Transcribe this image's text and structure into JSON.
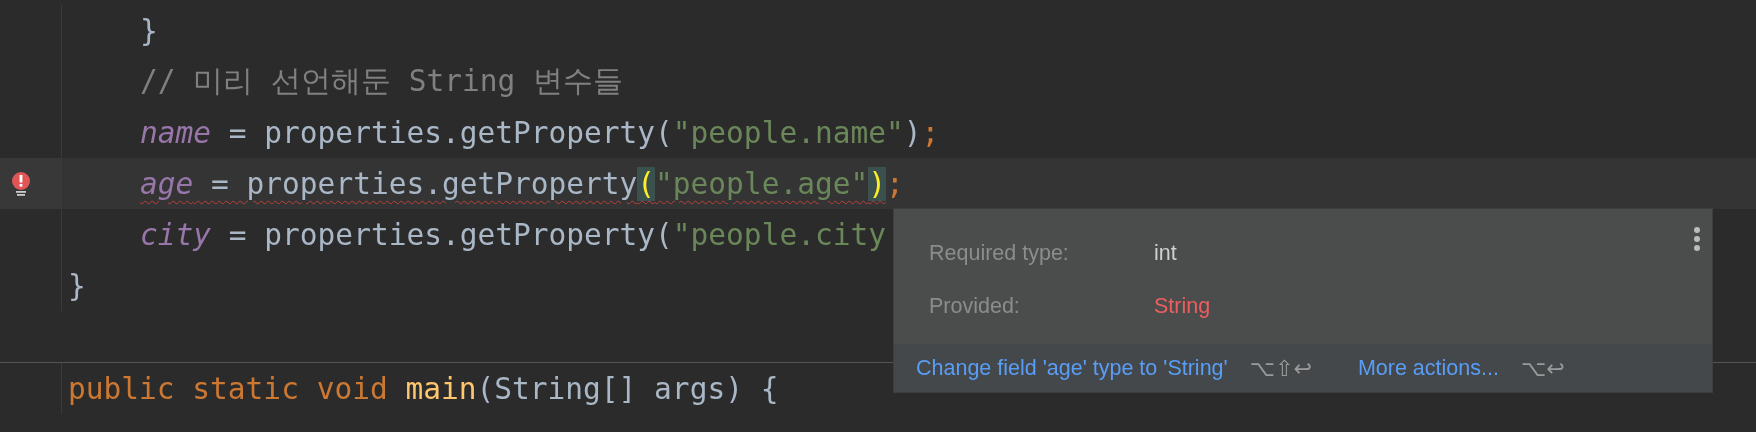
{
  "editor": {
    "lines": [
      {
        "current": false,
        "error": false,
        "indented": true,
        "tokens": [
          {
            "kind": "plain",
            "text": "}"
          }
        ]
      },
      {
        "current": false,
        "error": false,
        "indented": true,
        "tokens": [
          {
            "kind": "comment",
            "text": "// 미리 선언해둔 String 변수들"
          }
        ]
      },
      {
        "current": false,
        "error": false,
        "indented": true,
        "tokens": [
          {
            "kind": "field",
            "text": "name"
          },
          {
            "kind": "plain",
            "text": " = properties.getProperty("
          },
          {
            "kind": "string",
            "text": "\"people.name\""
          },
          {
            "kind": "plain",
            "text": ")"
          },
          {
            "kind": "semicolon",
            "text": ";"
          }
        ]
      },
      {
        "current": true,
        "error": true,
        "indented": true,
        "tokens": [
          {
            "kind": "field",
            "text": "age",
            "error": true
          },
          {
            "kind": "plain",
            "text": " = properties.getProperty",
            "error": true
          },
          {
            "kind": "brace_match",
            "text": "(",
            "error": true
          },
          {
            "kind": "string",
            "text": "\"people.age\"",
            "error": true
          },
          {
            "kind": "brace_match",
            "text": ")",
            "error": true
          },
          {
            "kind": "semicolon",
            "text": ";"
          }
        ]
      },
      {
        "current": false,
        "error": false,
        "indented": true,
        "tokens": [
          {
            "kind": "field",
            "text": "city"
          },
          {
            "kind": "plain",
            "text": " = properties.getProperty("
          },
          {
            "kind": "string",
            "text": "\"people.city"
          }
        ]
      },
      {
        "current": false,
        "error": false,
        "indented": false,
        "tokens": [
          {
            "kind": "plain",
            "text": "}"
          }
        ]
      },
      {
        "current": false,
        "error": false,
        "indented": false,
        "separator_before": true,
        "tokens": [
          {
            "kind": "keyword",
            "text": "public static void "
          },
          {
            "kind": "method",
            "text": "main"
          },
          {
            "kind": "plain",
            "text": "(String[] args) {"
          }
        ]
      }
    ]
  },
  "popup": {
    "rows": [
      {
        "label": "Required type:",
        "value": "int",
        "kind": "normal"
      },
      {
        "label": "Provided:",
        "value": "String",
        "kind": "error"
      }
    ],
    "actions": [
      {
        "label": "Change field 'age' type to 'String'",
        "shortcut": "⌥⇧↩"
      },
      {
        "label": "More actions...",
        "shortcut": "⌥↩"
      }
    ]
  }
}
